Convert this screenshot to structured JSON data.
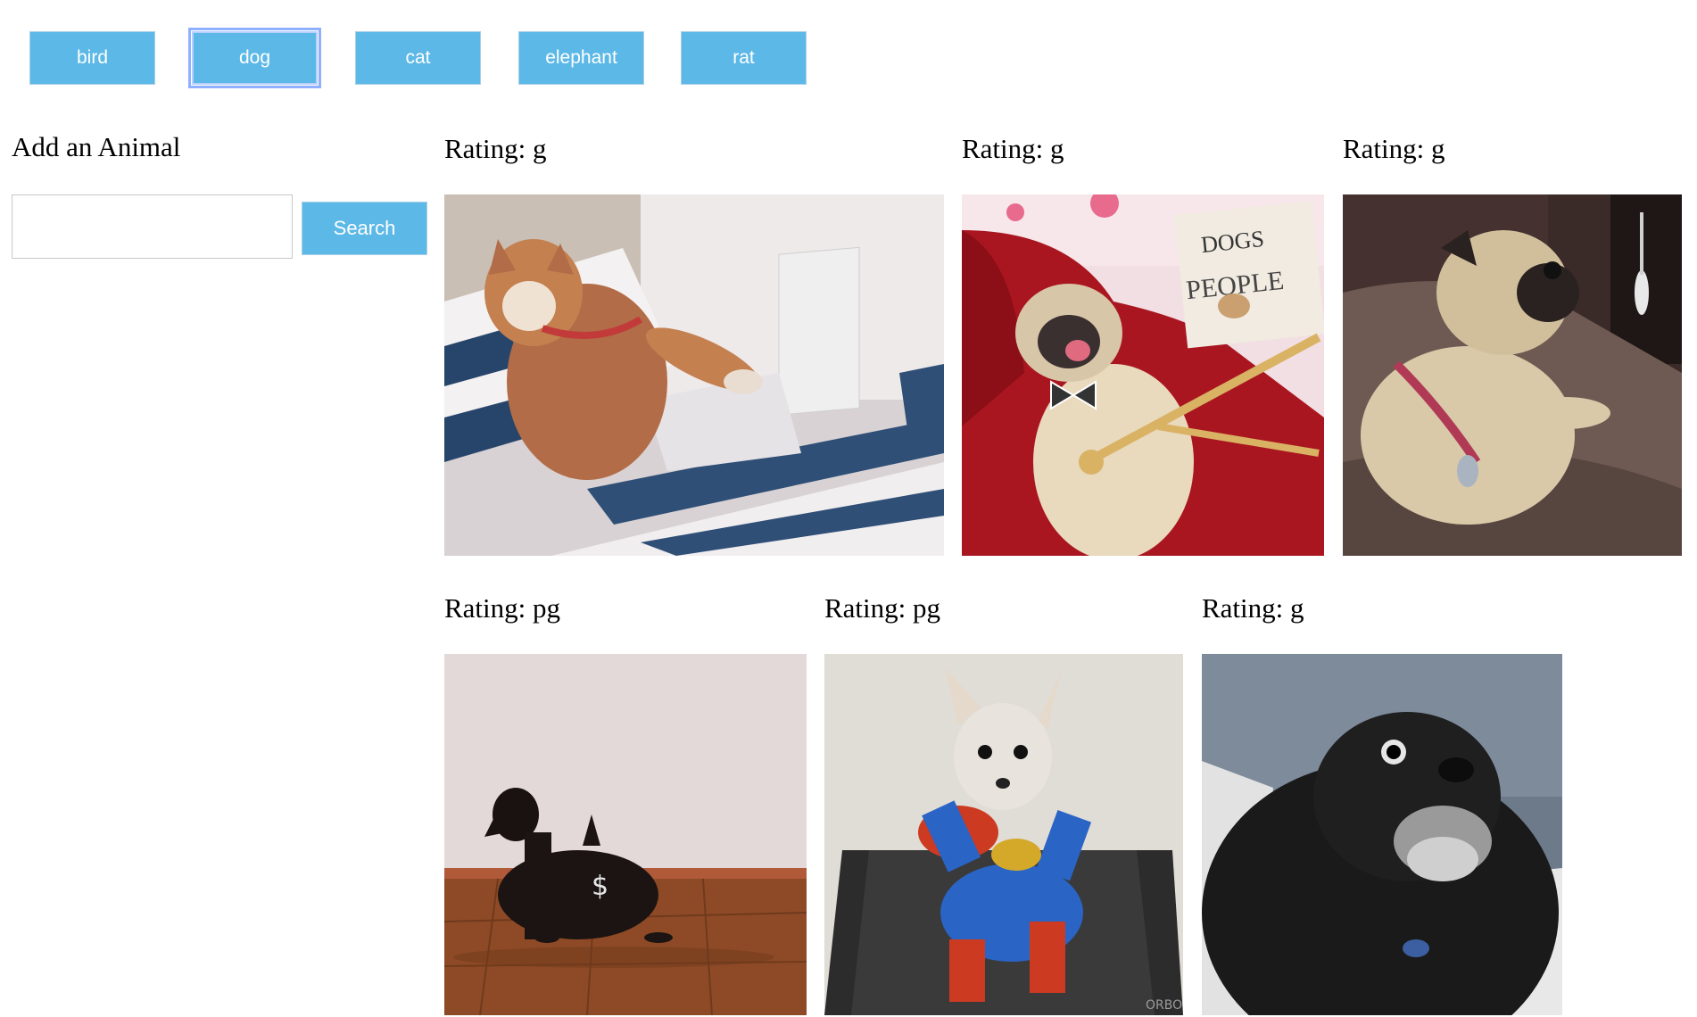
{
  "animal_buttons": [
    "bird",
    "dog",
    "cat",
    "elephant",
    "rat"
  ],
  "active_animal": "dog",
  "add_form": {
    "title": "Add an Animal",
    "input_value": "",
    "search_label": "Search"
  },
  "rating_prefix": "Rating:",
  "gifs": [
    {
      "rating": "g",
      "subject": "shiba-laptop",
      "text": ""
    },
    {
      "rating": "g",
      "subject": "pug-bowtie",
      "text": "DOGS and their PEOPLE"
    },
    {
      "rating": "g",
      "subject": "pug-sitting",
      "text": ""
    },
    {
      "rating": "pg",
      "subject": "dachshund",
      "text": ""
    },
    {
      "rating": "pg",
      "subject": "chihuahua-superman",
      "text": "ORBO"
    },
    {
      "rating": "g",
      "subject": "black-dog",
      "text": ""
    }
  ]
}
